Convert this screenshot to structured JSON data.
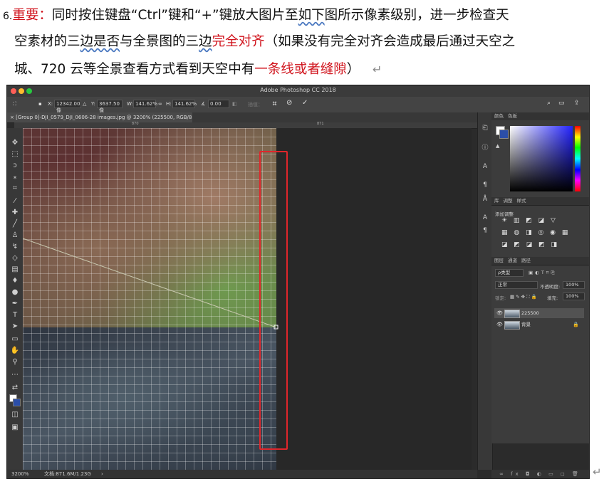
{
  "doc": {
    "line1_num": "6.",
    "line1_label": "重要：",
    "line1_a": "同时按住键盘“Ctrl”键和“+”键放大图片至",
    "line1_b": "如下",
    "line1_c": "图所示像素级别，进一步检查天",
    "line2_a": "空素材的三",
    "line2_b": "边是否",
    "line2_c": "与全景图的三",
    "line2_d": "边",
    "line2_red": "完全对齐",
    "line2_e": "（如果没有完全对齐会造成最后通过天空之",
    "line3_a": "城、720 云等全景查看方式看到天空中有",
    "line3_red": "一条线或者缝隙",
    "line3_b": "）",
    "return_mark": "↵"
  },
  "ps": {
    "app_title": "Adobe Photoshop CC 2018",
    "options": {
      "x_label": "X:",
      "x_value": "12342.00 像",
      "y_label": "Y:",
      "y_value": "3637.50 像",
      "w_label": "W:",
      "w_value": "141.62%",
      "h_label": "H:",
      "h_value": "141.62%",
      "angle_value": "0.00",
      "interp": "插值：",
      "cancel_icon": "⊘",
      "commit_icon": "✓"
    },
    "tab_title": "[Group 0]-DJI_0579_DJI_0606-28 images.jpg @ 3200% (225500, RGB/8)",
    "ruler_mark_1": "870",
    "ruler_mark_2": "871",
    "color_tabs": [
      "颜色",
      "色板"
    ],
    "adjust_tabs": [
      "库",
      "调整",
      "样式"
    ],
    "adjust_label": "添加调整",
    "adjust_row1": "☀ ▥ ◩ ◪ ▽",
    "adjust_row2": "▦ ◍ ◨ ◎ ◉ ▦",
    "adjust_row3": "◪ ◩ ◪ ◩ ◨",
    "layer_tabs": [
      "图层",
      "通道",
      "路径"
    ],
    "kind_label": "ρ类型",
    "blend_mode": "正常",
    "opacity_label": "不透明度:",
    "opacity_value": "100%",
    "lock_label": "锁定:",
    "fill_label": "填充:",
    "fill_value": "100%",
    "layers": [
      {
        "name": "225500"
      },
      {
        "name": "背景"
      }
    ],
    "status_zoom": "3200%",
    "status_doc": "文档:871.6M/1.23G",
    "status_arrow": "›",
    "panel_footer": "∞ fx ◘ ◐ ▭ ◻ 🗑"
  },
  "colors": {
    "accent_red": "#d0121b",
    "highlight_box": "#e0262b"
  }
}
